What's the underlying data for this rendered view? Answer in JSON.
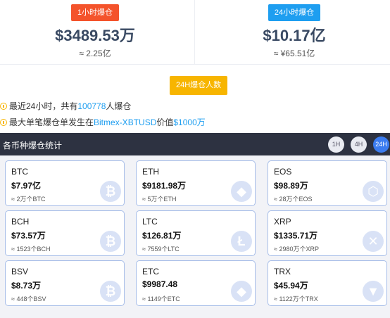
{
  "stats": {
    "left": {
      "tag": "1小时爆仓",
      "amount": "$3489.53万",
      "approx": "≈ 2.25亿"
    },
    "right": {
      "tag": "24小时爆仓",
      "amount": "$10.17亿",
      "approx": "≈ ¥65.51亿"
    }
  },
  "people": {
    "tag": "24H爆仓人数",
    "line1_prefix": "最近24小时，共有",
    "line1_count": "100778",
    "line1_suffix": "人爆仓",
    "line2_prefix": "最大单笔爆仓单发生在",
    "line2_market": "Bitmex-XBTUSD",
    "line2_mid": "价值",
    "line2_value": "$1000万"
  },
  "section": {
    "title": "各币种爆仓统计",
    "timeframes": [
      "1H",
      "4H",
      "24H"
    ],
    "active": "24H"
  },
  "coins": [
    {
      "symbol": "BTC",
      "value": "$7.97亿",
      "sub": "≈ 2万个BTC",
      "icon": "bitcoin-icon",
      "glyph": "₿"
    },
    {
      "symbol": "ETH",
      "value": "$9181.98万",
      "sub": "≈ 5万个ETH",
      "icon": "ethereum-icon",
      "glyph": "◆"
    },
    {
      "symbol": "EOS",
      "value": "$98.89万",
      "sub": "≈ 28万个EOS",
      "icon": "eos-icon",
      "glyph": "⬡"
    },
    {
      "symbol": "BCH",
      "value": "$73.57万",
      "sub": "≈ 1523个BCH",
      "icon": "bitcoin-cash-icon",
      "glyph": "₿"
    },
    {
      "symbol": "LTC",
      "value": "$126.81万",
      "sub": "≈ 7559个LTC",
      "icon": "litecoin-icon",
      "glyph": "Ł"
    },
    {
      "symbol": "XRP",
      "value": "$1335.71万",
      "sub": "≈ 2980万个XRP",
      "icon": "xrp-icon",
      "glyph": "✕"
    },
    {
      "symbol": "BSV",
      "value": "$8.73万",
      "sub": "≈ 448个BSV",
      "icon": "bsv-icon",
      "glyph": "₿"
    },
    {
      "symbol": "ETC",
      "value": "$9987.48",
      "sub": "≈ 1149个ETC",
      "icon": "ethereum-classic-icon",
      "glyph": "◆"
    },
    {
      "symbol": "TRX",
      "value": "$45.94万",
      "sub": "≈ 1122万个TRX",
      "icon": "tron-icon",
      "glyph": "▼"
    }
  ]
}
